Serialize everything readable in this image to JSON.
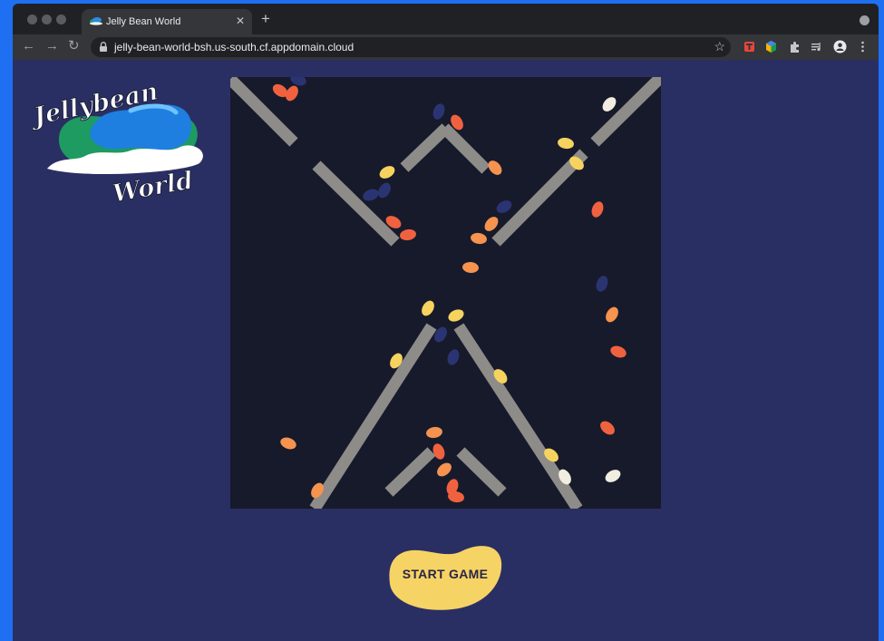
{
  "browser": {
    "tab_title": "Jelly Bean World",
    "tab_close": "✕",
    "new_tab": "+",
    "url": "jelly-bean-world-bsh.us-south.cf.appdomain.cloud",
    "back": "←",
    "forward": "→",
    "reload": "↻",
    "star": "☆"
  },
  "logo": {
    "line1": "Jellybean",
    "line2": "World"
  },
  "game": {
    "start_label": "START GAME",
    "colors": {
      "background": "#171a2b",
      "ramp": "#8e8c88",
      "bean_red": "#f0623f",
      "bean_orange": "#f5934f",
      "bean_yellow": "#f6d35f",
      "bean_white": "#f1ede0",
      "bean_navy": "#2b3473",
      "button": "#f6d365"
    },
    "beans": [
      {
        "c": "bean_red"
      },
      {
        "c": "bean_red"
      },
      {
        "c": "bean_navy"
      },
      {
        "c": "bean_white"
      },
      {
        "c": "bean_navy"
      },
      {
        "c": "bean_red"
      },
      {
        "c": "bean_yellow"
      },
      {
        "c": "bean_yellow"
      },
      {
        "c": "bean_yellow"
      },
      {
        "c": "bean_orange"
      },
      {
        "c": "bean_navy"
      },
      {
        "c": "bean_navy"
      },
      {
        "c": "bean_red"
      },
      {
        "c": "bean_red"
      },
      {
        "c": "bean_orange"
      },
      {
        "c": "bean_orange"
      },
      {
        "c": "bean_navy"
      },
      {
        "c": "bean_red"
      },
      {
        "c": "bean_orange"
      },
      {
        "c": "bean_yellow"
      },
      {
        "c": "bean_yellow"
      },
      {
        "c": "bean_navy"
      },
      {
        "c": "bean_navy"
      },
      {
        "c": "bean_navy"
      },
      {
        "c": "bean_orange"
      },
      {
        "c": "bean_red"
      },
      {
        "c": "bean_yellow"
      },
      {
        "c": "bean_yellow"
      },
      {
        "c": "bean_red"
      },
      {
        "c": "bean_orange"
      },
      {
        "c": "bean_orange"
      },
      {
        "c": "bean_red"
      },
      {
        "c": "bean_orange"
      },
      {
        "c": "bean_red"
      },
      {
        "c": "bean_yellow"
      },
      {
        "c": "bean_white"
      },
      {
        "c": "bean_white"
      },
      {
        "c": "bean_orange"
      },
      {
        "c": "bean_red"
      }
    ]
  }
}
